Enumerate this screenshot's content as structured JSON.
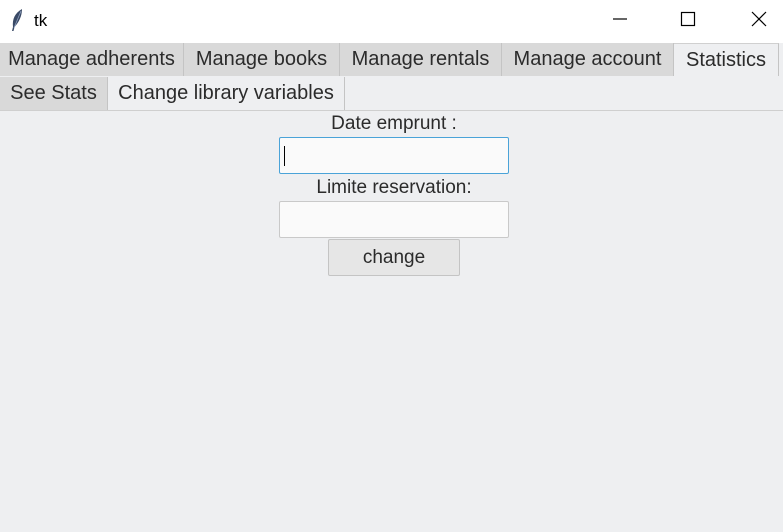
{
  "window": {
    "title": "tk",
    "icons": {
      "app": "feather-icon",
      "minimize": "minimize-icon",
      "maximize": "maximize-icon",
      "close": "close-icon"
    }
  },
  "tabs": [
    {
      "label": "Manage adherents",
      "active": false
    },
    {
      "label": "Manage books",
      "active": false
    },
    {
      "label": "Manage rentals",
      "active": false
    },
    {
      "label": "Manage account",
      "active": false
    },
    {
      "label": "Statistics",
      "active": true
    }
  ],
  "subtabs": [
    {
      "label": "See Stats",
      "selected": true
    },
    {
      "label": "Change library variables",
      "selected": false
    }
  ],
  "form": {
    "date_label": "Date emprunt :",
    "date_value": "",
    "limit_label": "Limite reservation:",
    "limit_value": "",
    "change_label": "change"
  },
  "colors": {
    "background": "#eeeff1",
    "tab_inactive": "#d9d9d9",
    "focus_border": "#4aa3d8"
  }
}
